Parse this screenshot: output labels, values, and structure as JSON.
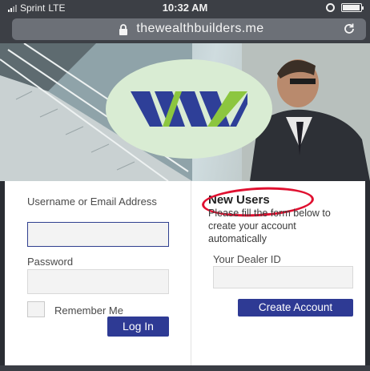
{
  "status_bar": {
    "carrier": "Sprint",
    "network": "LTE",
    "time": "10:32 AM",
    "battery_level": 0.95
  },
  "browser": {
    "url": "thewealthbuilders.me"
  },
  "hero": {
    "logo_text": "WW",
    "colors": {
      "logo_blue": "#2e3f98",
      "logo_green": "#8cc63f",
      "circle": "#d9ecd3"
    }
  },
  "login": {
    "username_label": "Username or Email Address",
    "username_value": "",
    "password_label": "Password",
    "password_value": "",
    "remember_label": "Remember Me",
    "remember_checked": false,
    "login_button": "Log In"
  },
  "register": {
    "heading": "New Users",
    "description": "Please fill the form below to create your account automatically",
    "dealer_label": "Your Dealer ID",
    "dealer_value": "",
    "create_button": "Create Account"
  },
  "colors": {
    "accent": "#2e3a94",
    "annotation": "#e01030"
  }
}
